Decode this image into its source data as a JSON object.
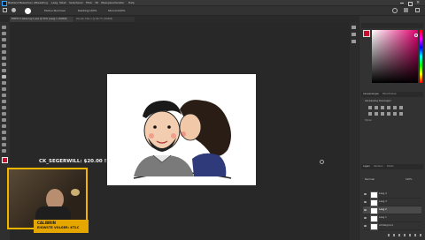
{
  "menu": {
    "items": [
      "Bestand",
      "Bewerken",
      "Afbeelding",
      "Laag",
      "Tekst",
      "Selecteren",
      "Filter",
      "3D",
      "Weergave",
      "Venster",
      "Help"
    ]
  },
  "options": {
    "mode_label": "Modus:",
    "mode_value": "Normaal",
    "opacity_label": "Dekking:",
    "opacity_value": "100%",
    "flow_label": "Stroom:",
    "flow_value": "100%"
  },
  "tabs": [
    {
      "label": "EMPTY-2-tekening-1.psd @ 50% (Laag 1, RGB/8)"
    },
    {
      "label": "Zonder titel-1 @ 66,7% (RGB/8)"
    }
  ],
  "overlay": {
    "amount_text": "CK_SEGERWILL: $20.00 !!!",
    "caption_name": "CALIBRIN",
    "caption_sub": "EIGWSTE VOLGER: KTLC"
  },
  "adjust": {
    "tabs": [
      "Aanpassingen",
      "Bibliotheken"
    ],
    "line1": "Aanpassing toevoegen",
    "line2": "Stijlen"
  },
  "layers": {
    "tabs": [
      "Lagen",
      "Kanalen",
      "Paden"
    ],
    "blend_value": "Normaal",
    "opacity_value": "100%",
    "rows": [
      {
        "name": "Laag 4"
      },
      {
        "name": "Laag 3"
      },
      {
        "name": "Laag 2"
      },
      {
        "name": "Laag 1"
      },
      {
        "name": "Achtergrond"
      }
    ]
  },
  "colors": {
    "accent": "#31a8ff",
    "foreground": "#c8102e",
    "background": "#ffffff",
    "overlay_border": "#f1b500"
  },
  "icons": [
    "home-icon",
    "brush-icon",
    "search-icon",
    "workspace-icon",
    "share-icon"
  ]
}
